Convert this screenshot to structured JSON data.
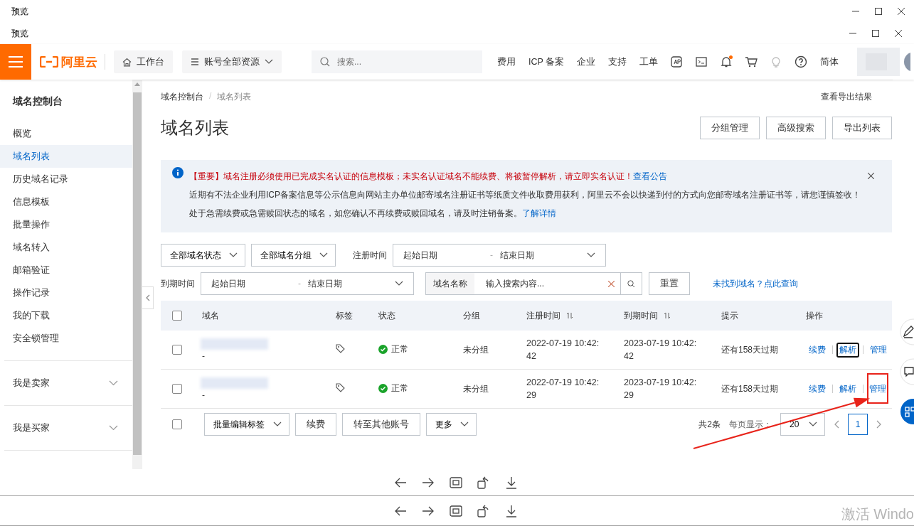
{
  "outer_window": {
    "title": "预览"
  },
  "inner_window": {
    "title": "预览"
  },
  "topbar": {
    "logo": "阿里云",
    "workbench": "工作台",
    "resources": "账号全部资源",
    "search": {
      "placeholder": "搜索..."
    },
    "links": [
      "费用",
      "ICP 备案",
      "企业",
      "支持",
      "工单"
    ],
    "notification_dot": true,
    "language": "简体"
  },
  "sidebar": {
    "title": "域名控制台",
    "items": [
      {
        "label": "概览",
        "selected": false
      },
      {
        "label": "域名列表",
        "selected": true
      },
      {
        "label": "历史域名记录",
        "selected": false
      },
      {
        "label": "信息模板",
        "selected": false
      },
      {
        "label": "批量操作",
        "selected": false
      },
      {
        "label": "域名转入",
        "selected": false
      },
      {
        "label": "邮箱验证",
        "selected": false
      },
      {
        "label": "操作记录",
        "selected": false
      },
      {
        "label": "我的下载",
        "selected": false
      },
      {
        "label": "安全锁管理",
        "selected": false
      }
    ],
    "groups": [
      {
        "label": "我是卖家",
        "expanded": false
      },
      {
        "label": "我是买家",
        "expanded": false
      }
    ]
  },
  "breadcrumb": {
    "separator": "/",
    "items": [
      {
        "label": "域名控制台",
        "current": false
      },
      {
        "label": "域名列表",
        "current": true
      }
    ]
  },
  "export_results": "查看导出结果",
  "page_title": "域名列表",
  "header_buttons": [
    "分组管理",
    "高级搜索",
    "导出列表"
  ],
  "notice": {
    "lines": [
      {
        "kind": "important",
        "tag": "【重要】",
        "text": "域名注册必须使用已完成实名认证的信息模板；未实名认证域名不能续费、将被暂停解析，请立即实名认证！",
        "link": "查看公告"
      },
      {
        "kind": "plain",
        "text": "近期有不法企业利用ICP备案信息等公示信息向网站主办单位邮寄域名注册证书等纸质文件收取费用获利，阿里云不会以快递到付的方式向您邮寄域名注册证书等，请您谨慎签收！"
      },
      {
        "kind": "plain",
        "text": "处于急需续费或急需赎回状态的域名，如您确认不再续费或赎回域名，请及时注销备案。",
        "link": "了解详情"
      }
    ]
  },
  "filters": {
    "status": "全部域名状态",
    "group": "全部域名分组",
    "reg_label": "注册时间",
    "reg_range": {
      "start": {
        "placeholder": "起始日期"
      },
      "separator": "-",
      "end": {
        "placeholder": "结束日期"
      }
    },
    "exp_label": "到期时间",
    "exp_range": {
      "start": {
        "placeholder": "起始日期"
      },
      "separator": "-",
      "end": {
        "placeholder": "结束日期"
      }
    },
    "search_label": "域名名称",
    "search": {
      "placeholder": "输入搜索内容..."
    },
    "reset": "重置",
    "not_found_link": "未找到域名？点此查询"
  },
  "table": {
    "header_checked": false,
    "columns": [
      {
        "label": "域名",
        "sortable": false
      },
      {
        "label": "标签",
        "sortable": false
      },
      {
        "label": "状态",
        "sortable": false
      },
      {
        "label": "分组",
        "sortable": false
      },
      {
        "label": "注册时间",
        "sortable": true
      },
      {
        "label": "到期时间",
        "sortable": true
      },
      {
        "label": "提示",
        "sortable": false
      },
      {
        "label": "操作",
        "sortable": false
      }
    ],
    "rows": [
      {
        "checked": false,
        "name_note": "-",
        "status": "正常",
        "group": "未分组",
        "registered": "2022-07-19 10:42:42",
        "expires": "2023-07-19 10:42:42",
        "hint": "还有158天过期",
        "actions": [
          {
            "label": "续费",
            "focused": false,
            "highlighted": false
          },
          {
            "label": "解析",
            "focused": true,
            "highlighted": false
          },
          {
            "label": "管理",
            "focused": false,
            "highlighted": false
          }
        ]
      },
      {
        "checked": false,
        "name_note": "-",
        "status": "正常",
        "group": "未分组",
        "registered": "2022-07-19 10:42:29",
        "expires": "2023-07-19 10:42:29",
        "hint": "还有158天过期",
        "actions": [
          {
            "label": "续费",
            "focused": false,
            "highlighted": false
          },
          {
            "label": "解析",
            "focused": false,
            "highlighted": false
          },
          {
            "label": "管理",
            "focused": false,
            "highlighted": true
          }
        ]
      }
    ]
  },
  "footer": {
    "checked": false,
    "batch_tag": "批量编辑标签",
    "renew": "续费",
    "transfer": "转至其他账号",
    "more": "更多",
    "total": "共2条",
    "per_page_label": "每页显示：",
    "per_page": "20",
    "pages": [
      {
        "label": "1",
        "selected": true
      }
    ]
  },
  "windows_notice": "激活 Windo"
}
